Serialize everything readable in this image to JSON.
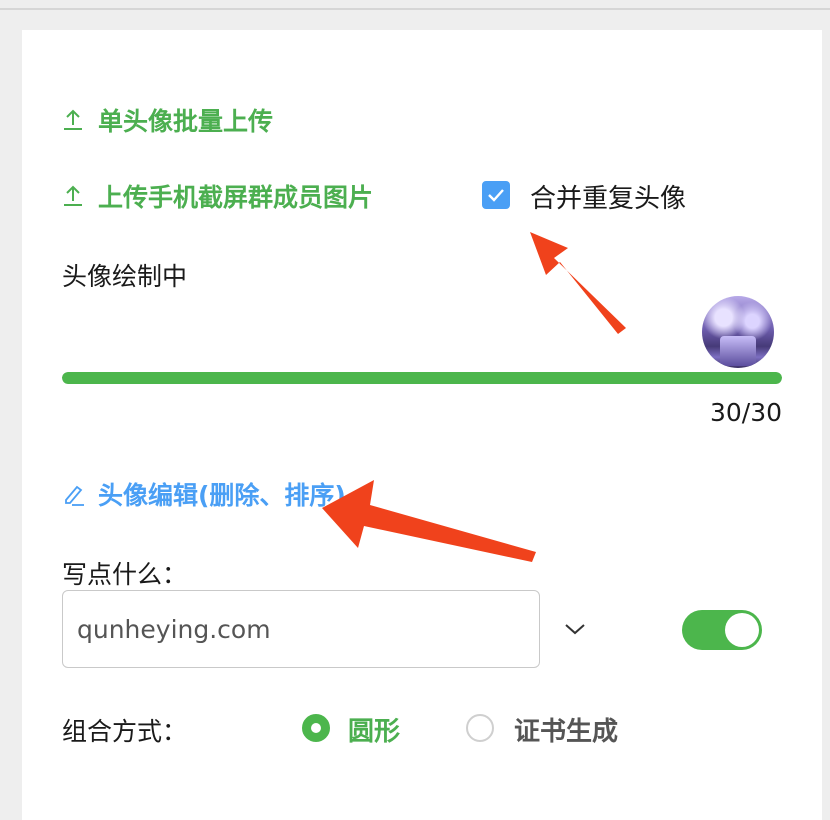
{
  "links": {
    "single_upload": "单头像批量上传",
    "screenshot_upload": "上传手机截屏群成员图片",
    "edit": "头像编辑(删除、排序)"
  },
  "merge_checkbox": {
    "label": "合并重复头像",
    "checked": true
  },
  "status": {
    "text": "头像绘制中"
  },
  "progress": {
    "current": 30,
    "total": 30,
    "text": "30/30",
    "fraction": 1.0
  },
  "write": {
    "label": "写点什么：",
    "value": "qunheying.com",
    "toggle_on": true
  },
  "combination": {
    "label": "组合方式：",
    "options": [
      {
        "label": "圆形",
        "selected": true
      },
      {
        "label": "证书生成",
        "selected": false
      }
    ]
  },
  "colors": {
    "accent_green": "#4cb64c",
    "accent_blue": "#4a9ff5",
    "annotation_arrow": "#f0421c"
  },
  "icons": [
    "upload-icon",
    "edit-pencil-icon",
    "check-icon",
    "chevron-down-icon"
  ]
}
